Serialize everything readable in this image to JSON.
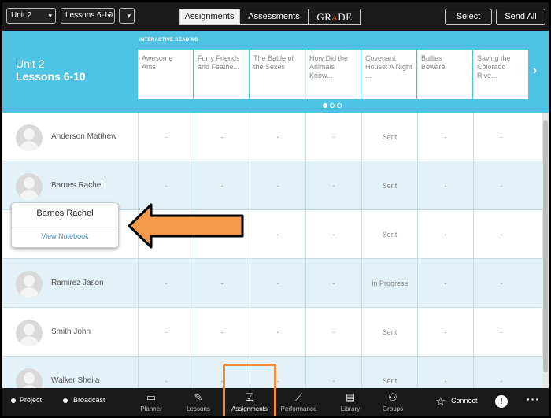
{
  "topbar": {
    "unit_select": "Unit 2",
    "lessons_select": "Lessons 6-10",
    "extra_select": "",
    "tabs": [
      "Assignments",
      "Assessments"
    ],
    "grade_logo": "GRADE",
    "select_label": "Select",
    "send_all_label": "Send All"
  },
  "header": {
    "unit": "Unit 2",
    "lessons": "Lessons 6-10",
    "group_label": "INTERACTIVE READING",
    "columns": [
      "Awesome Ants!",
      "Furry Friends and Feathe...",
      "The Battle of the Sexes",
      "How Did the Animals Know...",
      "Covenant House: A Night ...",
      "Bullies Beware!",
      "Saving the Colorado Rive..."
    ],
    "page_dots": 3,
    "active_dot": 1
  },
  "students": [
    {
      "name": "Anderson Matthew",
      "cells": [
        "-",
        "-",
        "-",
        "-",
        "Sent",
        "-",
        "-"
      ]
    },
    {
      "name": "Barnes Rachel",
      "cells": [
        "-",
        "-",
        "-",
        "-",
        "Sent",
        "-",
        "-"
      ]
    },
    {
      "name": "",
      "cells": [
        "-",
        "-",
        "-",
        "-",
        "Sent",
        "-",
        "-"
      ]
    },
    {
      "name": "Ramirez Jason",
      "cells": [
        "-",
        "-",
        "-",
        "-",
        "In Progress",
        "-",
        "-"
      ]
    },
    {
      "name": "Smith John",
      "cells": [
        "-",
        "-",
        "-",
        "-",
        "Sent",
        "-",
        "-"
      ]
    },
    {
      "name": "Walker Sheila",
      "cells": [
        "-",
        "-",
        "-",
        "-",
        "Sent",
        "-",
        "-"
      ]
    }
  ],
  "popup": {
    "name": "Barnes Rachel",
    "link": "View Notebook"
  },
  "bottombar": {
    "project": "Project",
    "broadcast": "Broadcast",
    "nav": [
      {
        "label": "Planner",
        "icon": "book-icon"
      },
      {
        "label": "Lessons",
        "icon": "edit-icon"
      },
      {
        "label": "Assignments",
        "icon": "checkbox-icon"
      },
      {
        "label": "Performance",
        "icon": "chart-icon"
      },
      {
        "label": "Library",
        "icon": "library-icon"
      },
      {
        "label": "Groups",
        "icon": "groups-icon"
      }
    ],
    "connect": "Connect"
  },
  "colors": {
    "band": "#4fc3e3",
    "row_alt": "#e2f2f8",
    "highlight": "#f48a3c",
    "arrow_fill": "#f49a4c"
  }
}
